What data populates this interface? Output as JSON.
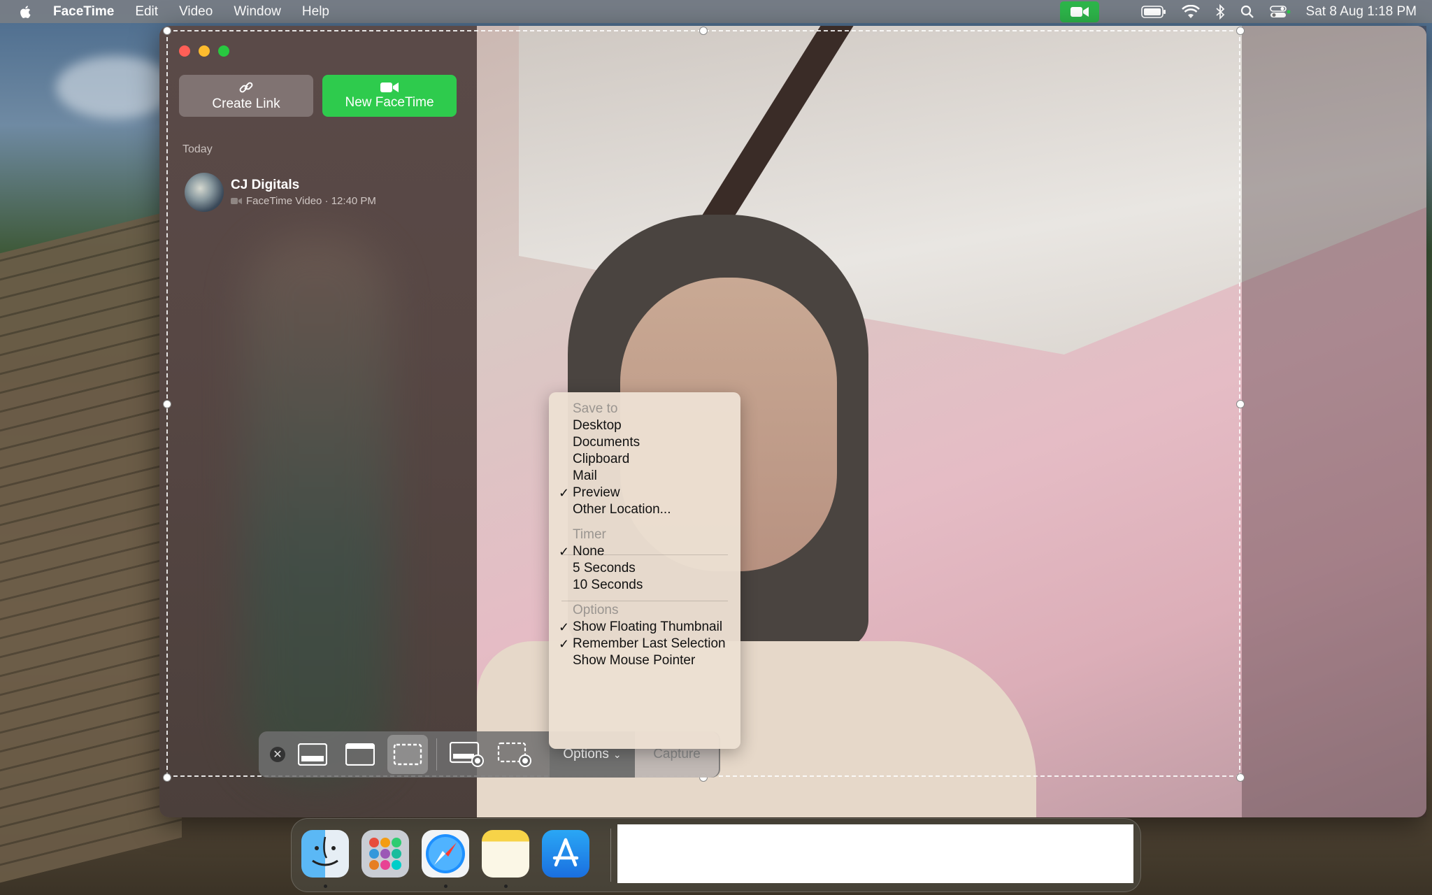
{
  "menubar": {
    "app_name": "FaceTime",
    "items": [
      "Edit",
      "Video",
      "Window",
      "Help"
    ],
    "datetime": "Sat 8 Aug  1:18 PM"
  },
  "sidebar": {
    "create_link_label": "Create Link",
    "new_facetime_label": "New FaceTime",
    "section_today": "Today",
    "recents": [
      {
        "name": "CJ Digitals",
        "detail": "FaceTime Video · 12:40 PM"
      }
    ]
  },
  "capture_toolbar": {
    "options_label": "Options",
    "capture_label": "Capture"
  },
  "options_menu": {
    "save_to_header": "Save to",
    "save_to": [
      "Desktop",
      "Documents",
      "Clipboard",
      "Mail",
      "Preview",
      "Other Location..."
    ],
    "save_to_checked": "Preview",
    "timer_header": "Timer",
    "timer": [
      "None",
      "5 Seconds",
      "10 Seconds"
    ],
    "timer_checked": "None",
    "options_header": "Options",
    "options": [
      "Show Floating Thumbnail",
      "Remember Last Selection",
      "Show Mouse Pointer"
    ],
    "options_checked": [
      "Show Floating Thumbnail",
      "Remember Last Selection"
    ]
  },
  "colors": {
    "accent_green": "#2ecb4d",
    "close": "#ff5f57",
    "minimize": "#febc2e",
    "maximize": "#28c840"
  }
}
